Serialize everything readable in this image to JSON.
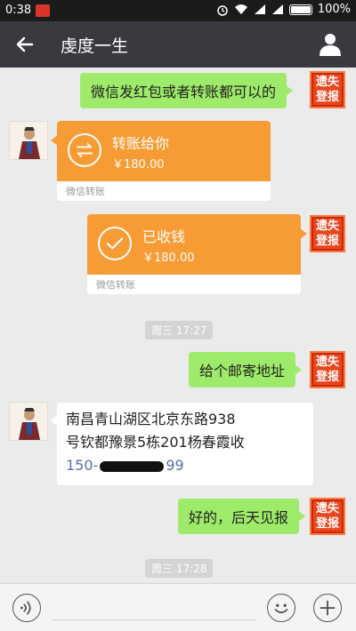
{
  "status_bar": {
    "time": "0:38",
    "battery": "100%"
  },
  "header": {
    "title": "虔度一生"
  },
  "messages": {
    "m1": {
      "text": "微信发红包或者转账都可以的"
    },
    "m2": {
      "title": "转账给你",
      "amount": "￥180.00",
      "footer": "微信转账"
    },
    "m3": {
      "title": "已收钱",
      "amount": "￥180.00",
      "footer": "微信转账"
    },
    "t1": {
      "text": "周三 17:27"
    },
    "m4": {
      "text": "给个邮寄地址"
    },
    "m5": {
      "line1": "南昌青山湖区北京东路938",
      "line2": "号钦都豫景5栋201杨春霞收",
      "phone_prefix": "150-",
      "phone_suffix": "99"
    },
    "m6": {
      "text": "好的，后天见报"
    },
    "t2": {
      "text": "周三 17:28"
    }
  },
  "stamp": {
    "line1": "遗失",
    "line2": "登报"
  },
  "colors": {
    "green_bubble": "#9eea6a",
    "transfer_orange": "#f79c34",
    "header_bg": "#393a3f",
    "stamp_red": "#e8461d"
  },
  "icons": [
    "back-arrow-icon",
    "profile-icon",
    "voice-icon",
    "emoji-icon",
    "plus-icon",
    "transfer-arrows-icon",
    "check-icon",
    "alarm-icon",
    "wifi-icon",
    "signal-icon",
    "battery-icon"
  ]
}
